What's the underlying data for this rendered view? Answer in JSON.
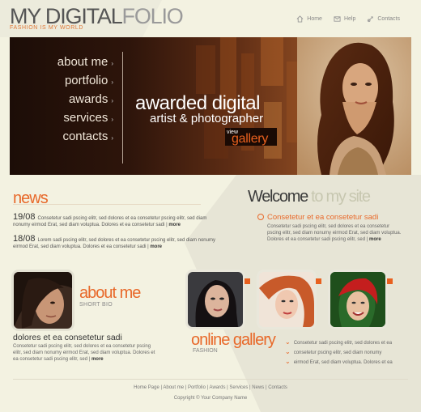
{
  "header": {
    "logo_part1": "MY DIGITAL",
    "logo_part2": "FOLIO",
    "tagline": "FASHION IS MY WORLD",
    "nav": [
      {
        "label": "Home",
        "icon": "home-icon"
      },
      {
        "label": "Help",
        "icon": "help-icon"
      },
      {
        "label": "Contacts",
        "icon": "contacts-icon"
      }
    ]
  },
  "banner": {
    "menu": [
      "about me",
      "portfolio",
      "awards",
      "services",
      "contacts"
    ],
    "title": "awarded digital",
    "subtitle": "artist & photographer",
    "view_label": "view",
    "gallery_label": "gallery"
  },
  "news": {
    "heading": "news",
    "items": [
      {
        "date": "19/08",
        "text": "Consetetur sadi pscing elitr, sed dolores et ea consetetur pscing elitr, sed diam nonumy eirmod Erat, sed diam voluptua. Dolores et ea consetetur sadi",
        "more": "more"
      },
      {
        "date": "18/08",
        "text": "Lorem sadi pscing elitr, sed dolores et ea consetetur pscing elitr, sed diam nonumy eirmod Erat, sed diam voluptua. Dolores et ea consetetur sadi",
        "more": "more"
      }
    ]
  },
  "welcome": {
    "heading_a": "Welcome",
    "heading_b": "to my site",
    "subheading": "Consetetur et ea consetetur sadi",
    "text": "Consetetur sadi pscing elitr, sed dolores et ea consetetur pscing elitr, sed diam nonumy eirmod Erat, sed diam voluptua. Dolores et ea consetetur sadi pscing elitr, sed",
    "more": "more"
  },
  "about": {
    "heading": "about me",
    "subheading": "SHORT BIO",
    "title": "dolores et ea consetetur sadi",
    "text": "Consetetur sadi pscing elitr, sed dolores et ea consetetur pscing elitr, sed diam nonumy eirmod Erat, sed diam voluptua. Dolores et ea consetetur sadi pscing elitr, sed",
    "more": "more"
  },
  "gallery": {
    "heading": "online gallery",
    "subheading": "FASHION",
    "list": [
      "Consetetur sadi pscing elitr, sed dolores et ea",
      "consetetur pscing elitr, sed diam nonumy",
      "eirmod Erat, sed diam voluptua. Dolores et ea"
    ]
  },
  "footer": {
    "links": [
      "Home Page",
      "About me",
      "Portfolio",
      "Awards",
      "Services",
      "News",
      "Contacts"
    ],
    "separator": "|",
    "copyright": "Copyright © Your Company Name"
  },
  "colors": {
    "accent": "#e8692a",
    "background": "#f3f2e1",
    "banner_dark": "#2e150b"
  }
}
